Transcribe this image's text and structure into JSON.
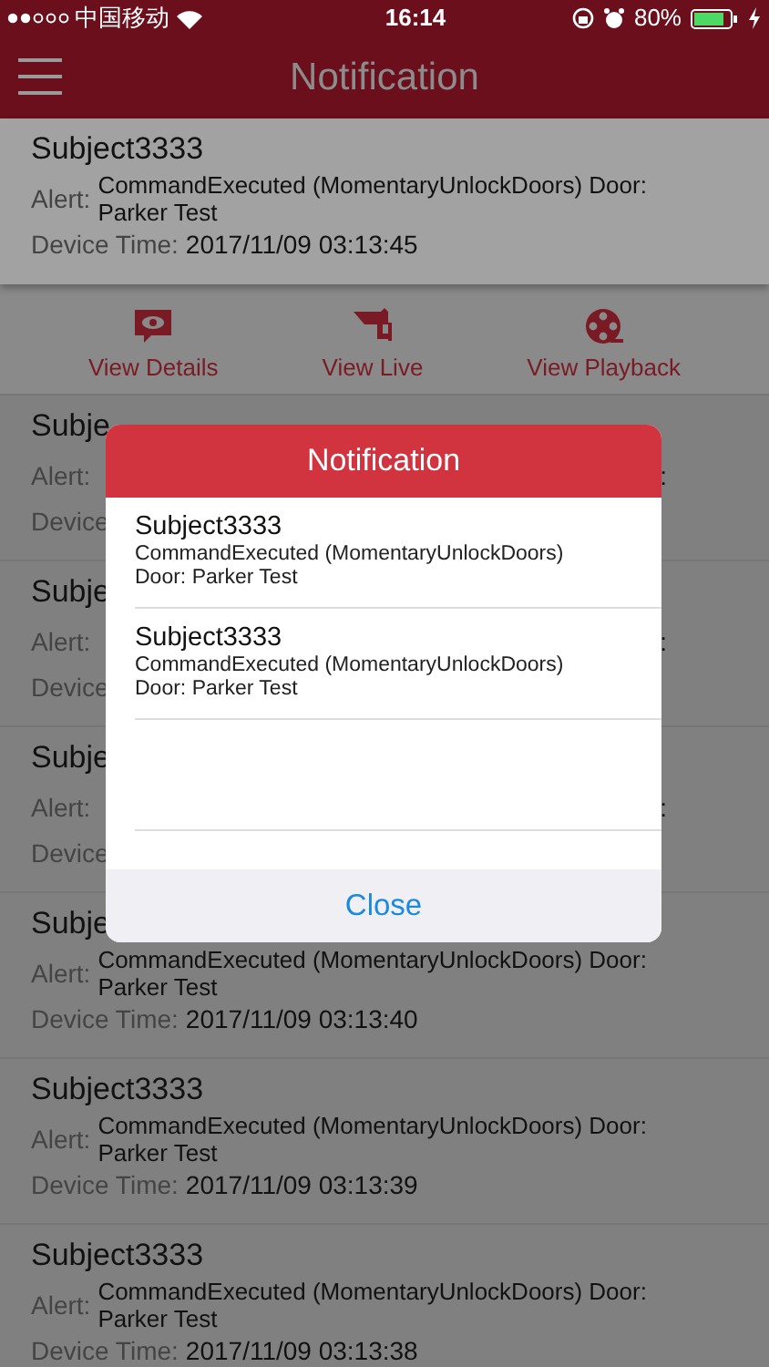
{
  "status_bar": {
    "carrier": "中国移动",
    "time": "16:14",
    "battery": "80%"
  },
  "nav": {
    "title": "Notification"
  },
  "notifications": [
    {
      "kind": "full",
      "selected": true,
      "title": "Subject3333",
      "alert_label": "Alert:",
      "alert": "CommandExecuted (MomentaryUnlockDoors) Door: Parker Test",
      "time_label": "Device Time:",
      "time": "2017/11/09 03:13:45"
    },
    {
      "kind": "covered",
      "selected": false,
      "title": "Subje",
      "alert_label": "Alert:",
      "alert": ":",
      "time_label": "Device"
    },
    {
      "kind": "covered",
      "selected": false,
      "title": "Subje",
      "alert_label": "Alert:",
      "alert": ":",
      "time_label": "Device"
    },
    {
      "kind": "covered",
      "selected": false,
      "title": "Subje",
      "alert_label": "Alert:",
      "alert": ":",
      "time_label": "Device"
    },
    {
      "kind": "full",
      "selected": false,
      "title": "Subje",
      "alert_label": "Alert:",
      "alert": "CommandExecuted (MomentaryUnlockDoors) Door: Parker Test",
      "time_label": "Device Time:",
      "time": "2017/11/09 03:13:40"
    },
    {
      "kind": "full",
      "selected": false,
      "title": "Subject3333",
      "alert_label": "Alert:",
      "alert": "CommandExecuted (MomentaryUnlockDoors) Door: Parker Test",
      "time_label": "Device Time:",
      "time": "2017/11/09 03:13:39"
    },
    {
      "kind": "full",
      "selected": false,
      "title": "Subject3333",
      "alert_label": "Alert:",
      "alert": "CommandExecuted (MomentaryUnlockDoors) Door: Parker Test",
      "time_label": "Device Time:",
      "time": "2017/11/09 03:13:38"
    }
  ],
  "actions": [
    {
      "kind": "details",
      "label": "View Details"
    },
    {
      "kind": "live",
      "label": "View Live"
    },
    {
      "kind": "playback",
      "label": "View Playback"
    }
  ],
  "dialog": {
    "title": "Notification",
    "items": [
      {
        "title": "Subject3333",
        "lines": [
          "CommandExecuted (MomentaryUnlockDoors)",
          "Door: Parker Test"
        ]
      },
      {
        "title": "Subject3333",
        "lines": [
          "CommandExecuted (MomentaryUnlockDoors)",
          "Door: Parker Test"
        ]
      }
    ],
    "button": "Close"
  }
}
